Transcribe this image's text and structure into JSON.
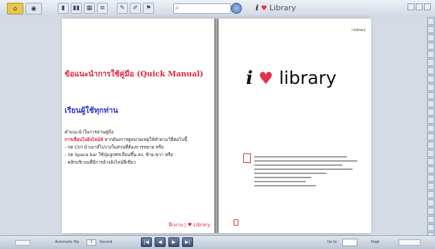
{
  "toolbar": {
    "search_placeholder": "",
    "brand_i": "i",
    "brand_heart": "♥",
    "brand_text": "Library"
  },
  "left_page": {
    "title": "ข้อแนะนำการใช้คู่มือ (Quick Manual)",
    "subtitle": "เรียนผู้ใช้ทุกท่าน",
    "line1": "คำแนะนำในการอ่านคู่มือ",
    "line2_red": "การเลื่อนไปยังไลน์ท์",
    "line2_rest": " หากต้องการดูหมายเหตุให้ทำตามวิธีต่อไปนี้",
    "line3": "- กด Ctrl นำเมาส์ไปวางในส่วนที่ต้องการขยาย หรือ",
    "line4": "- กด Space bar ใช้ปุ่มลูกศรเลื่อนขึ้น-ลง, ซ้าย-ขวา หรือ",
    "line5": "- คลิกบริเวณที่มีการอ้างอิงไลน์สีเขียว",
    "footer": "ฝึกงาน | ♥ Library"
  },
  "right_page": {
    "top_label": "i-Library",
    "logo_i": "i",
    "logo_heart": "♥",
    "logo_text": "library"
  },
  "statusbar": {
    "auto_flip_label": "Automatic flip",
    "auto_flip_value": "3",
    "second_label": "Second",
    "goto_label": "Go to:",
    "page_label": "Page"
  },
  "nav": {
    "first": "|◀",
    "prev": "◀",
    "next": "▶",
    "last": "▶|"
  },
  "colors": {
    "accent_red": "#e0213a",
    "accent_blue": "#2a33c8"
  }
}
